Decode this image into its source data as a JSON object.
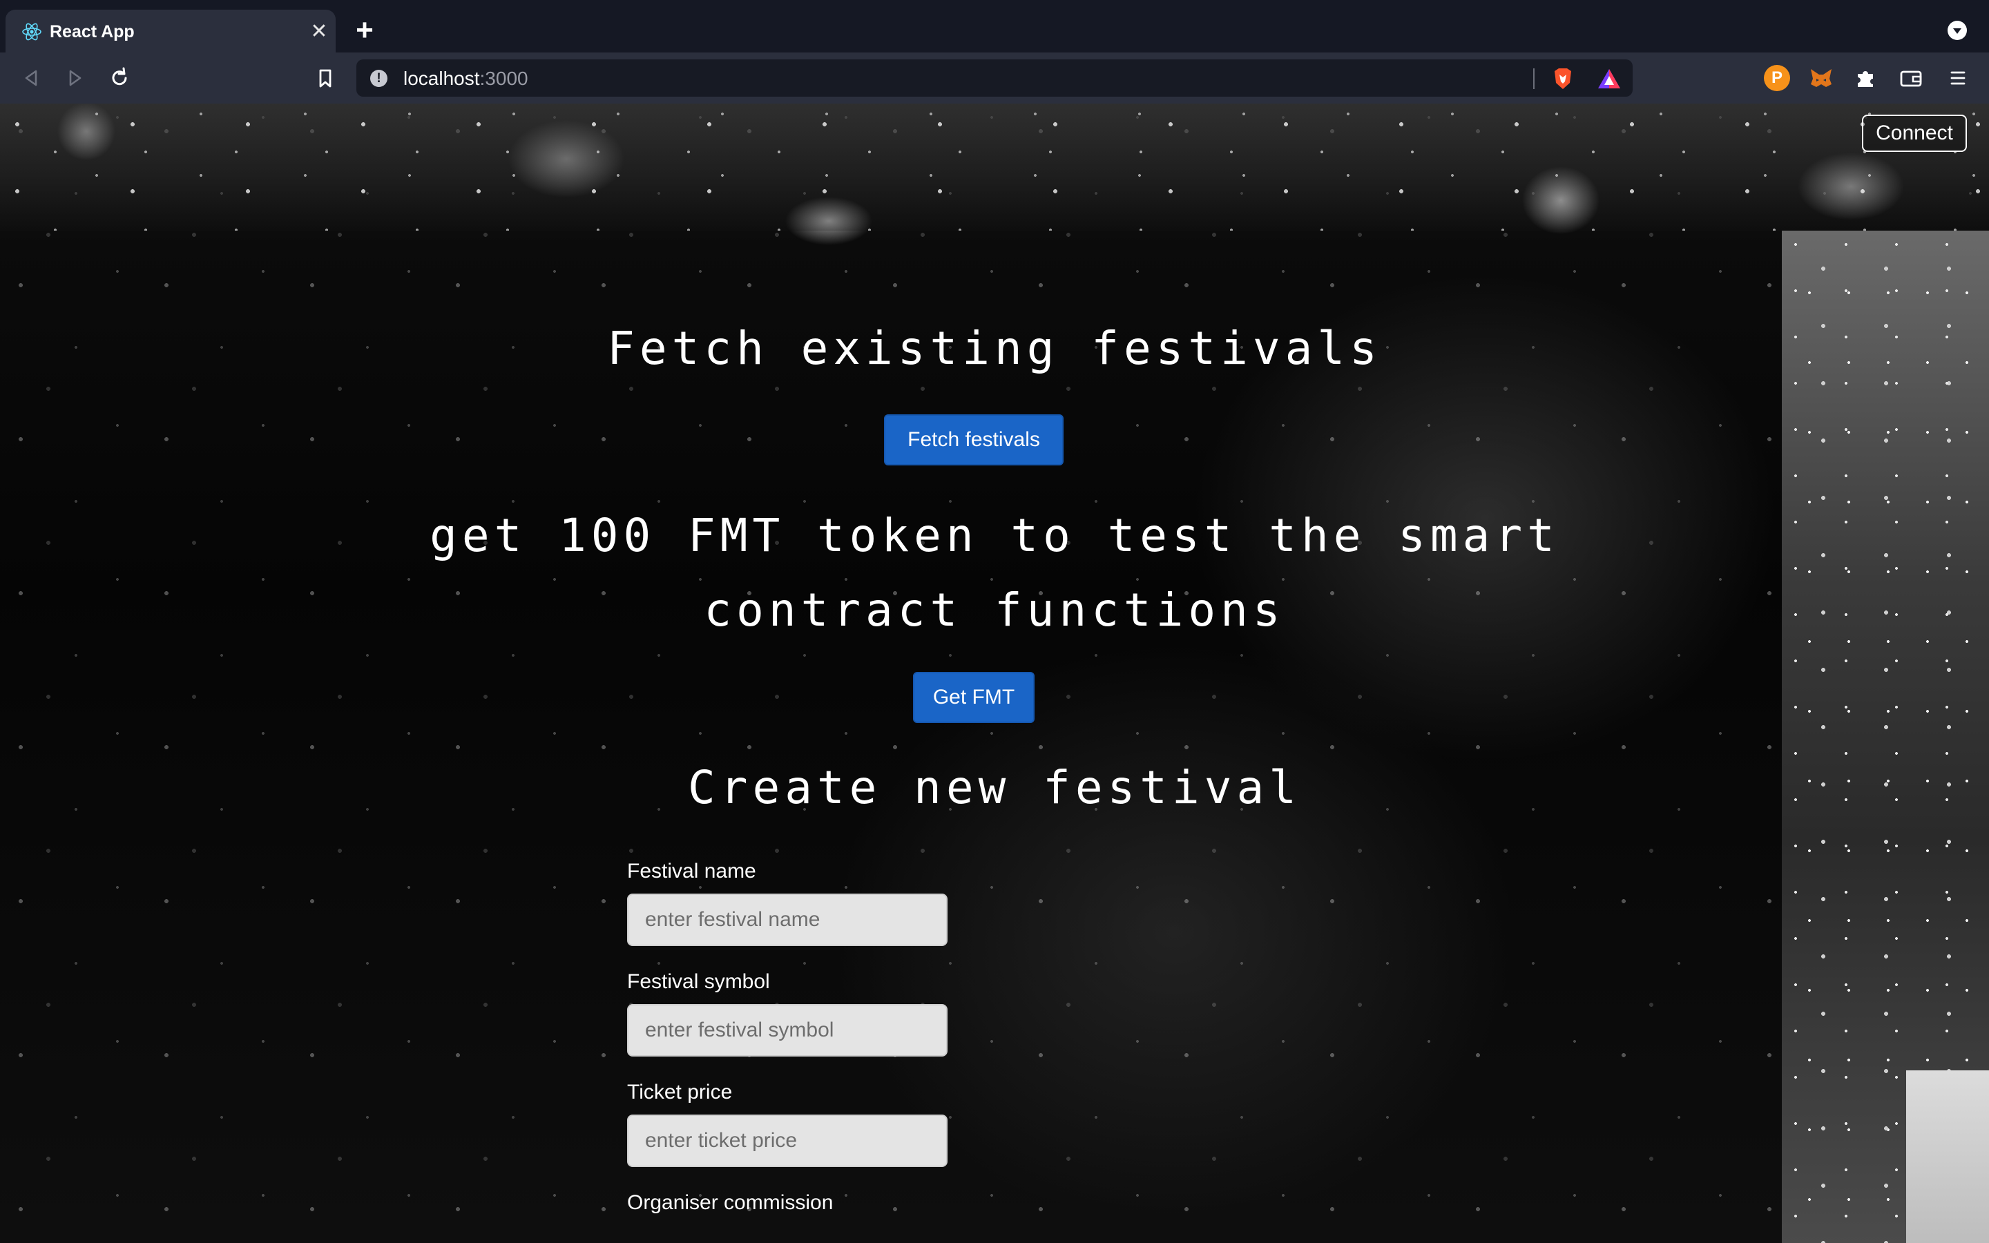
{
  "browser": {
    "tab_title": "React App",
    "tab_close": "✕",
    "new_tab": "+",
    "url_host": "localhost",
    "url_port": ":3000",
    "info_glyph": "!",
    "ext_p_glyph": "P",
    "icons": [
      "react-icon",
      "back-icon",
      "forward-icon",
      "reload-icon",
      "bookmark-icon",
      "info-icon",
      "brave-shields-icon",
      "brave-rewards-icon",
      "p-extension-icon",
      "metamask-icon",
      "extensions-icon",
      "wallet-icon",
      "menu-icon"
    ]
  },
  "header": {
    "connect_label": "Connect"
  },
  "fetch_section": {
    "heading": "Fetch existing festivals",
    "button_label": "Fetch festivals"
  },
  "token_section": {
    "heading": "get 100 FMT token to test the smart contract functions",
    "button_label": "Get FMT"
  },
  "create_section": {
    "heading": "Create new festival",
    "fields": [
      {
        "label": "Festival name",
        "placeholder": "enter festival name"
      },
      {
        "label": "Festival symbol",
        "placeholder": "enter festival symbol"
      },
      {
        "label": "Ticket price",
        "placeholder": "enter ticket price"
      },
      {
        "label": "Organiser commission",
        "placeholder": ""
      }
    ]
  },
  "colors": {
    "primary_button": "#1a65c7",
    "tab_bar": "#151824",
    "toolbar": "#2b2f3d"
  }
}
